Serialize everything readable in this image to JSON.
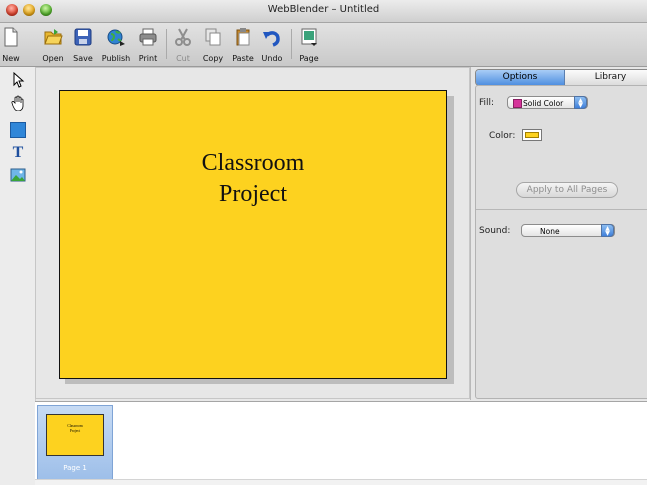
{
  "window": {
    "title": "WebBlender – Untitled"
  },
  "toolbar": {
    "new": "New",
    "open": "Open",
    "save": "Save",
    "publish": "Publish",
    "print": "Print",
    "cut": "Cut",
    "copy": "Copy",
    "paste": "Paste",
    "undo": "Undo",
    "page": "Page"
  },
  "tools": [
    "arrow-select-tool-icon",
    "hand-tool-icon",
    "rectangle-tool-icon",
    "text-tool-icon",
    "image-tool-icon"
  ],
  "canvas": {
    "page_title_line1": "Classroom",
    "page_title_line2": "Project",
    "page_color": "#fdd21f"
  },
  "panel": {
    "tabs": {
      "options": "Options",
      "library": "Library"
    },
    "fill_label": "Fill:",
    "fill_value": "Solid Color",
    "color_label": "Color:",
    "apply_button": "Apply to All Pages",
    "sound_label": "Sound:",
    "sound_value": "None"
  },
  "filmstrip": {
    "thumb_line1": "Classroom",
    "thumb_line2": "Project",
    "page_label": "Page 1"
  },
  "colors": {
    "accent": "#4f8fe0",
    "page": "#fdd21f",
    "fill_swatch": "#d5349a"
  }
}
